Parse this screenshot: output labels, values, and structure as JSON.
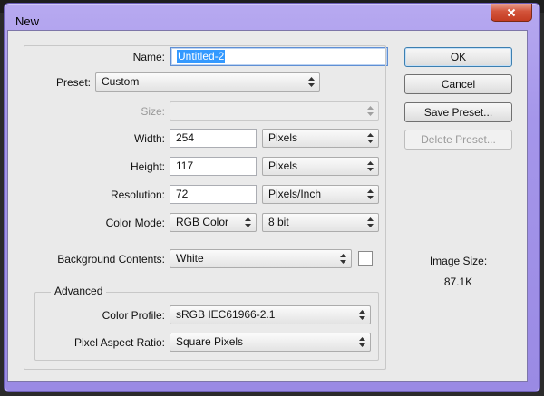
{
  "window": {
    "title": "New"
  },
  "name": {
    "label": "Name:",
    "value": "Untitled-2"
  },
  "preset": {
    "label": "Preset:",
    "value": "Custom"
  },
  "size": {
    "label": "Size:",
    "value": ""
  },
  "width": {
    "label": "Width:",
    "value": "254",
    "unit": "Pixels"
  },
  "height": {
    "label": "Height:",
    "value": "117",
    "unit": "Pixels"
  },
  "resolution": {
    "label": "Resolution:",
    "value": "72",
    "unit": "Pixels/Inch"
  },
  "color_mode": {
    "label": "Color Mode:",
    "value": "RGB Color",
    "bit_depth": "8 bit"
  },
  "background": {
    "label": "Background Contents:",
    "value": "White",
    "swatch_color": "#ffffff"
  },
  "advanced": {
    "legend": "Advanced",
    "color_profile": {
      "label": "Color Profile:",
      "value": "sRGB IEC61966-2.1"
    },
    "pixel_aspect": {
      "label": "Pixel Aspect Ratio:",
      "value": "Square Pixels"
    }
  },
  "buttons": {
    "ok": "OK",
    "cancel": "Cancel",
    "save_preset": "Save Preset...",
    "delete_preset": "Delete Preset..."
  },
  "image_size": {
    "label": "Image Size:",
    "value": "87.1K"
  },
  "icons": {
    "close": "close-icon",
    "select_arrows": "updown-arrows-icon"
  },
  "colors": {
    "title_bar": "#a596ea",
    "close_button": "#c94a30",
    "selection": "#3399ff"
  }
}
